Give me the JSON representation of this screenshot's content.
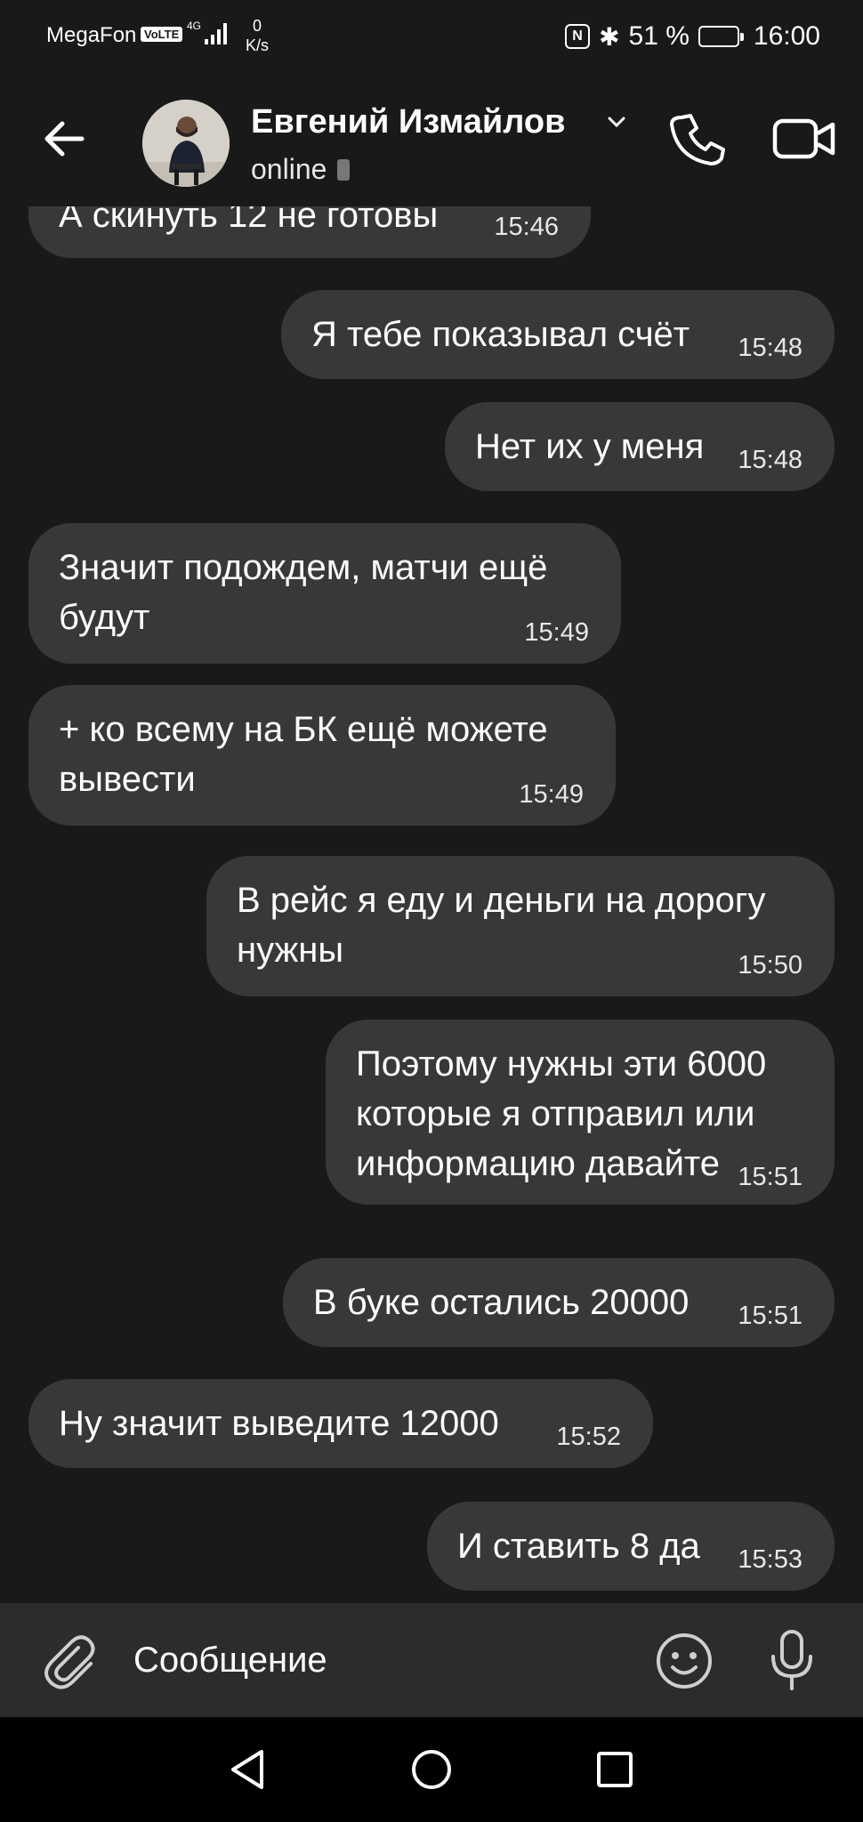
{
  "status_bar": {
    "carrier": "MegaFon",
    "volte": "VoLTE",
    "network": "4G",
    "speed_value": "0",
    "speed_unit": "K/s",
    "nfc": "N",
    "bluetooth": "✱",
    "battery": "51 %",
    "battery_level": 0.51,
    "time": "16:00"
  },
  "header": {
    "contact_name": "Евгений Измайлов",
    "status": "online",
    "icons": [
      "back-arrow-icon",
      "chevron-down-icon",
      "phone-icon",
      "video-camera-icon"
    ]
  },
  "messages": [
    {
      "direction": "incoming",
      "text": "А скинуть 12 не готовы",
      "time": "15:46"
    },
    {
      "direction": "outgoing",
      "text": "Я тебе показывал счёт",
      "time": "15:48"
    },
    {
      "direction": "outgoing",
      "text": "Нет их у меня",
      "time": "15:48"
    },
    {
      "direction": "incoming",
      "lines": [
        "Значит подождем, матчи ещё",
        "будут"
      ],
      "time": "15:49"
    },
    {
      "direction": "incoming",
      "lines": [
        "+ ко всему на БК ещё можете",
        "вывести"
      ],
      "time": "15:49"
    },
    {
      "direction": "outgoing",
      "lines": [
        "В рейс я еду и деньги на дорогу",
        "нужны"
      ],
      "time": "15:50"
    },
    {
      "direction": "outgoing",
      "lines": [
        "Поэтому нужны эти 6000",
        "которые я отправил или",
        "информацию давайте"
      ],
      "time": "15:51"
    },
    {
      "direction": "outgoing",
      "text": "В буке остались 20000",
      "time": "15:51"
    },
    {
      "direction": "incoming",
      "text": "Ну значит выведите 12000",
      "time": "15:52"
    },
    {
      "direction": "outgoing",
      "text": "И ставить 8 да",
      "time": "15:53"
    }
  ],
  "composer": {
    "placeholder": "Сообщение",
    "icons": [
      "paperclip-icon",
      "emoji-icon",
      "microphone-icon"
    ]
  },
  "navbar": {
    "icons": [
      "nav-back-icon",
      "nav-home-icon",
      "nav-recents-icon"
    ]
  },
  "colors": {
    "background": "#191919",
    "bubble": "#383839",
    "composer": "#2c2c2d",
    "navbar": "#000000"
  }
}
